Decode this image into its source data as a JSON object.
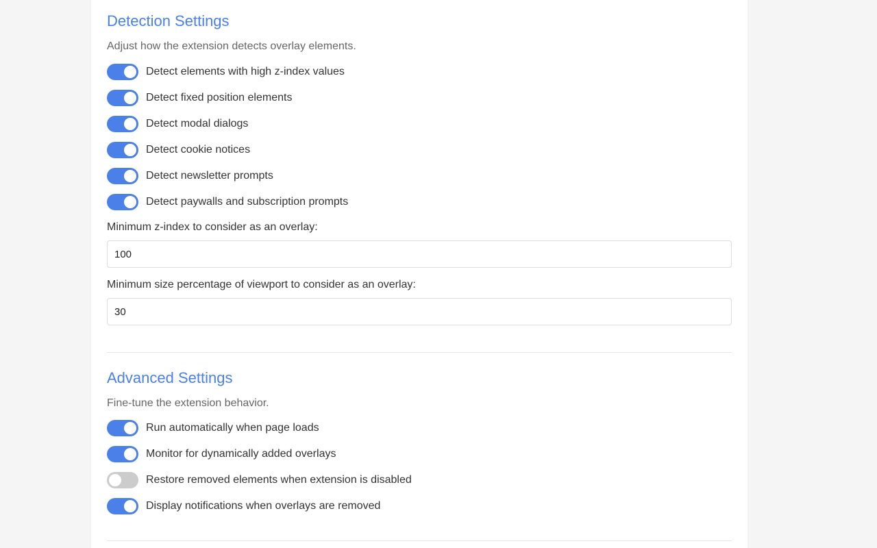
{
  "colors": {
    "accent": "#4a80e8",
    "toggle_off": "#cccccc",
    "page_background": "#f5f5f5"
  },
  "detection": {
    "title": "Detection Settings",
    "description": "Adjust how the extension detects overlay elements.",
    "toggles": [
      {
        "label": "Detect elements with high z-index values",
        "enabled": true
      },
      {
        "label": "Detect fixed position elements",
        "enabled": true
      },
      {
        "label": "Detect modal dialogs",
        "enabled": true
      },
      {
        "label": "Detect cookie notices",
        "enabled": true
      },
      {
        "label": "Detect newsletter prompts",
        "enabled": true
      },
      {
        "label": "Detect paywalls and subscription prompts",
        "enabled": true
      }
    ],
    "min_zindex_label": "Minimum z-index to consider as an overlay:",
    "min_zindex_value": "100",
    "min_size_label": "Minimum size percentage of viewport to consider as an overlay:",
    "min_size_value": "30"
  },
  "advanced": {
    "title": "Advanced Settings",
    "description": "Fine-tune the extension behavior.",
    "toggles": [
      {
        "label": "Run automatically when page loads",
        "enabled": true
      },
      {
        "label": "Monitor for dynamically added overlays",
        "enabled": true
      },
      {
        "label": "Restore removed elements when extension is disabled",
        "enabled": false
      },
      {
        "label": "Display notifications when overlays are removed",
        "enabled": true
      }
    ]
  }
}
